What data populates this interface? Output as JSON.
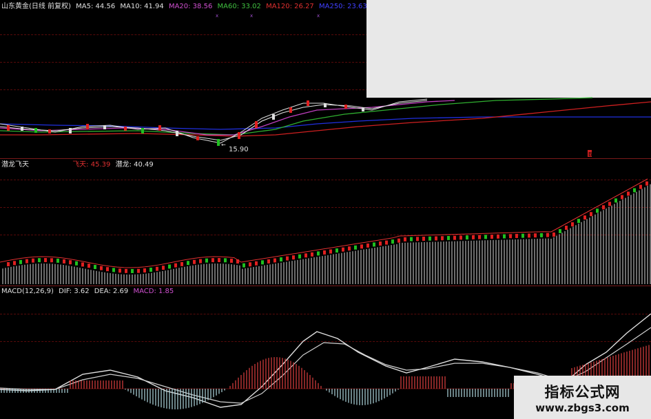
{
  "main": {
    "stock_label": "山东黄金(日线 前复权)",
    "ma": [
      {
        "label": "MA5: 44.56",
        "color": "#e0e0e0"
      },
      {
        "label": "MA10: 41.94",
        "color": "#e0e0e0"
      },
      {
        "label": "MA20: 38.56",
        "color": "#d050d0"
      },
      {
        "label": "MA60: 33.02",
        "color": "#40c040"
      },
      {
        "label": "MA120: 26.27",
        "color": "#e03030"
      },
      {
        "label": "MA250: 23.63",
        "color": "#3030e0"
      }
    ],
    "low_price": "15.90",
    "marker": "B"
  },
  "indicator": {
    "name": "潜龙飞天",
    "values": [
      {
        "label": "飞天: 45.39",
        "color": "#e03030"
      },
      {
        "label": "潜龙: 40.49",
        "color": "#e0e0e0"
      }
    ]
  },
  "macd": {
    "name": "MACD(12,26,9)",
    "values": [
      {
        "label": "DIF: 3.62",
        "color": "#e0e0e0"
      },
      {
        "label": "DEA: 2.69",
        "color": "#e0e0e0"
      },
      {
        "label": "MACD: 1.85",
        "color": "#d050d0"
      }
    ]
  },
  "watermark": {
    "title": "指标公式网",
    "url": "www.zbgs3.com"
  },
  "colors": {
    "up": "#e02020",
    "down": "#20c020",
    "neutral": "#e0e0e0",
    "background": "#000000"
  },
  "icons": [
    "x-marker-icon",
    "arrow-left-icon"
  ]
}
